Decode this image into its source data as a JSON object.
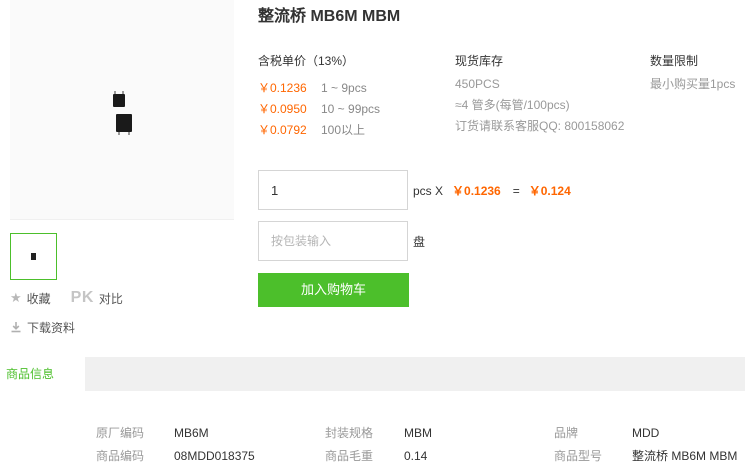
{
  "product": {
    "title": "整流桥 MB6M MBM"
  },
  "gallery": {
    "thumb_alt": "MB6M"
  },
  "side_actions": {
    "favorite_label": "收藏",
    "pk_label": "PK",
    "compare_label": "对比",
    "download_label": "下载资料"
  },
  "pricing": {
    "header": "含税单价（13%）",
    "tiers": [
      {
        "price": "￥0.1236",
        "range": "1 ~ 9pcs"
      },
      {
        "price": "￥0.0950",
        "range": "10 ~ 99pcs"
      },
      {
        "price": "￥0.0792",
        "range": "100以上"
      }
    ]
  },
  "stock": {
    "header": "现货库存",
    "amount": "450PCS",
    "packs": "≈4 管多(每管/100pcs)",
    "contact": "订货请联系客服QQ: 800158062"
  },
  "limit": {
    "header": "数量限制",
    "value": "最小购买量1pcs"
  },
  "order": {
    "quantity": "1",
    "unit_x": "pcs X",
    "unit_price": "￥0.1236",
    "equals": "=",
    "total": "￥0.124",
    "pack_placeholder": "按包装输入",
    "pack_unit": "盘",
    "cart_button": "加入购物车"
  },
  "tabs": {
    "info": "商品信息"
  },
  "specs": {
    "factory_code_label": "原厂编码",
    "factory_code": "MB6M",
    "package_label": "封装规格",
    "package": "MBM",
    "brand_label": "品牌",
    "brand": "MDD",
    "item_code_label": "商品编码",
    "item_code": "08MDD018375",
    "weight_label": "商品毛重",
    "weight": "0.14",
    "model_label": "商品型号",
    "model": "整流桥 MB6M MBM"
  },
  "colors": {
    "accent_green": "#4cbf2b",
    "price_orange": "#ff6600"
  }
}
